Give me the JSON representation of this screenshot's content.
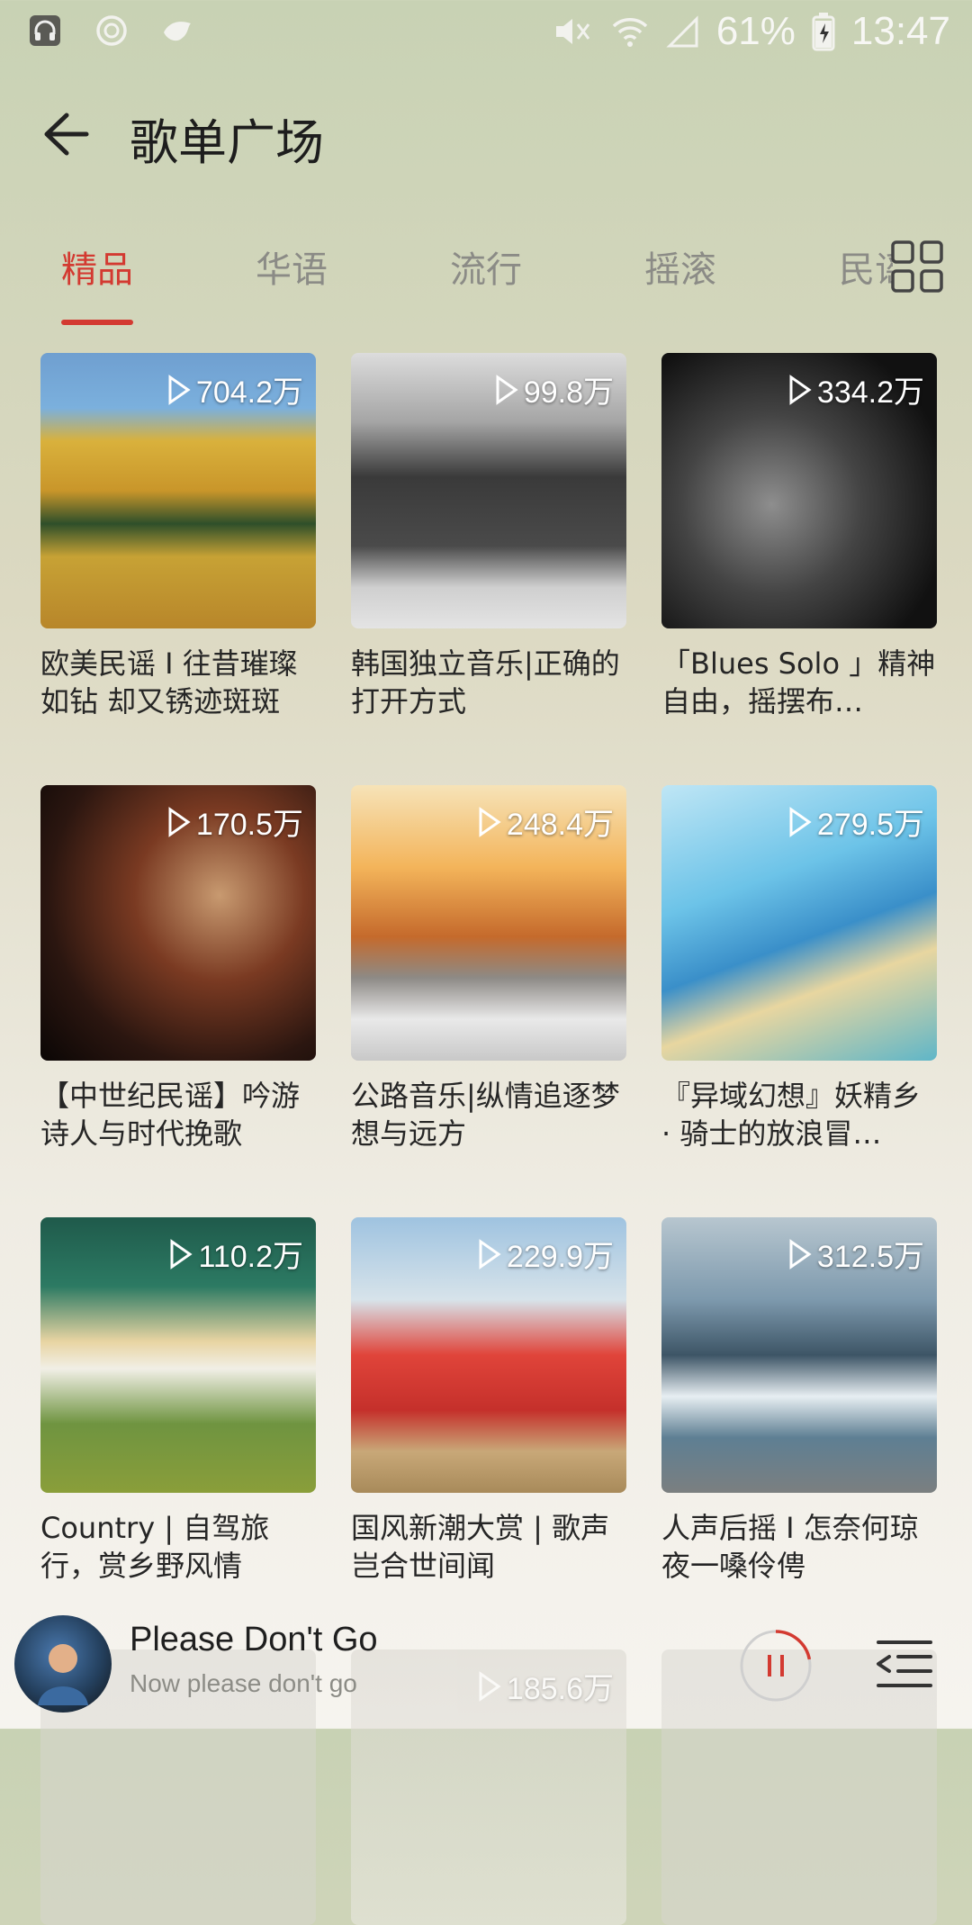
{
  "status_bar": {
    "battery": "61%",
    "time": "13:47",
    "left_icons": [
      "headphone-icon",
      "sync-icon",
      "bird-icon"
    ],
    "right_icons": [
      "mute-icon",
      "wifi-icon",
      "signal-icon",
      "battery-charging-icon"
    ]
  },
  "header": {
    "title": "歌单广场",
    "back_icon": "arrow-left-icon"
  },
  "tabs": [
    {
      "label": "精品",
      "active": true
    },
    {
      "label": "华语",
      "active": false
    },
    {
      "label": "流行",
      "active": false
    },
    {
      "label": "摇滚",
      "active": false
    },
    {
      "label": "民谣",
      "active": false
    }
  ],
  "grid_icon": "grid-icon",
  "accent_color": "#d33a31",
  "playlists": [
    {
      "play_count": "704.2万",
      "title": "欧美民谣 I 往昔璀璨如钻 却又锈迹斑斑"
    },
    {
      "play_count": "99.8万",
      "title": "韩国独立音乐|正确的打开方式"
    },
    {
      "play_count": "334.2万",
      "title": "「Blues Solo 」精神自由，摇摆布…"
    },
    {
      "play_count": "170.5万",
      "title": "【中世纪民谣】吟游诗人与时代挽歌"
    },
    {
      "play_count": "248.4万",
      "title": "公路音乐|纵情追逐梦想与远方"
    },
    {
      "play_count": "279.5万",
      "title": "『异域幻想』妖精乡 · 骑士的放浪冒…"
    },
    {
      "play_count": "110.2万",
      "title": "Country | 自驾旅行，赏乡野风情"
    },
    {
      "play_count": "229.9万",
      "title": "国风新潮大赏 | 歌声岂合世间闻"
    },
    {
      "play_count": "312.5万",
      "title": "人声后摇 I 怎奈何琼夜一嗓伶俜"
    },
    {
      "play_count": "",
      "title": ""
    },
    {
      "play_count": "185.6万",
      "title": ""
    },
    {
      "play_count": "",
      "title": ""
    }
  ],
  "player": {
    "song": "Please Don't Go",
    "subtitle": "Now please don't go",
    "progress": 0.22
  }
}
